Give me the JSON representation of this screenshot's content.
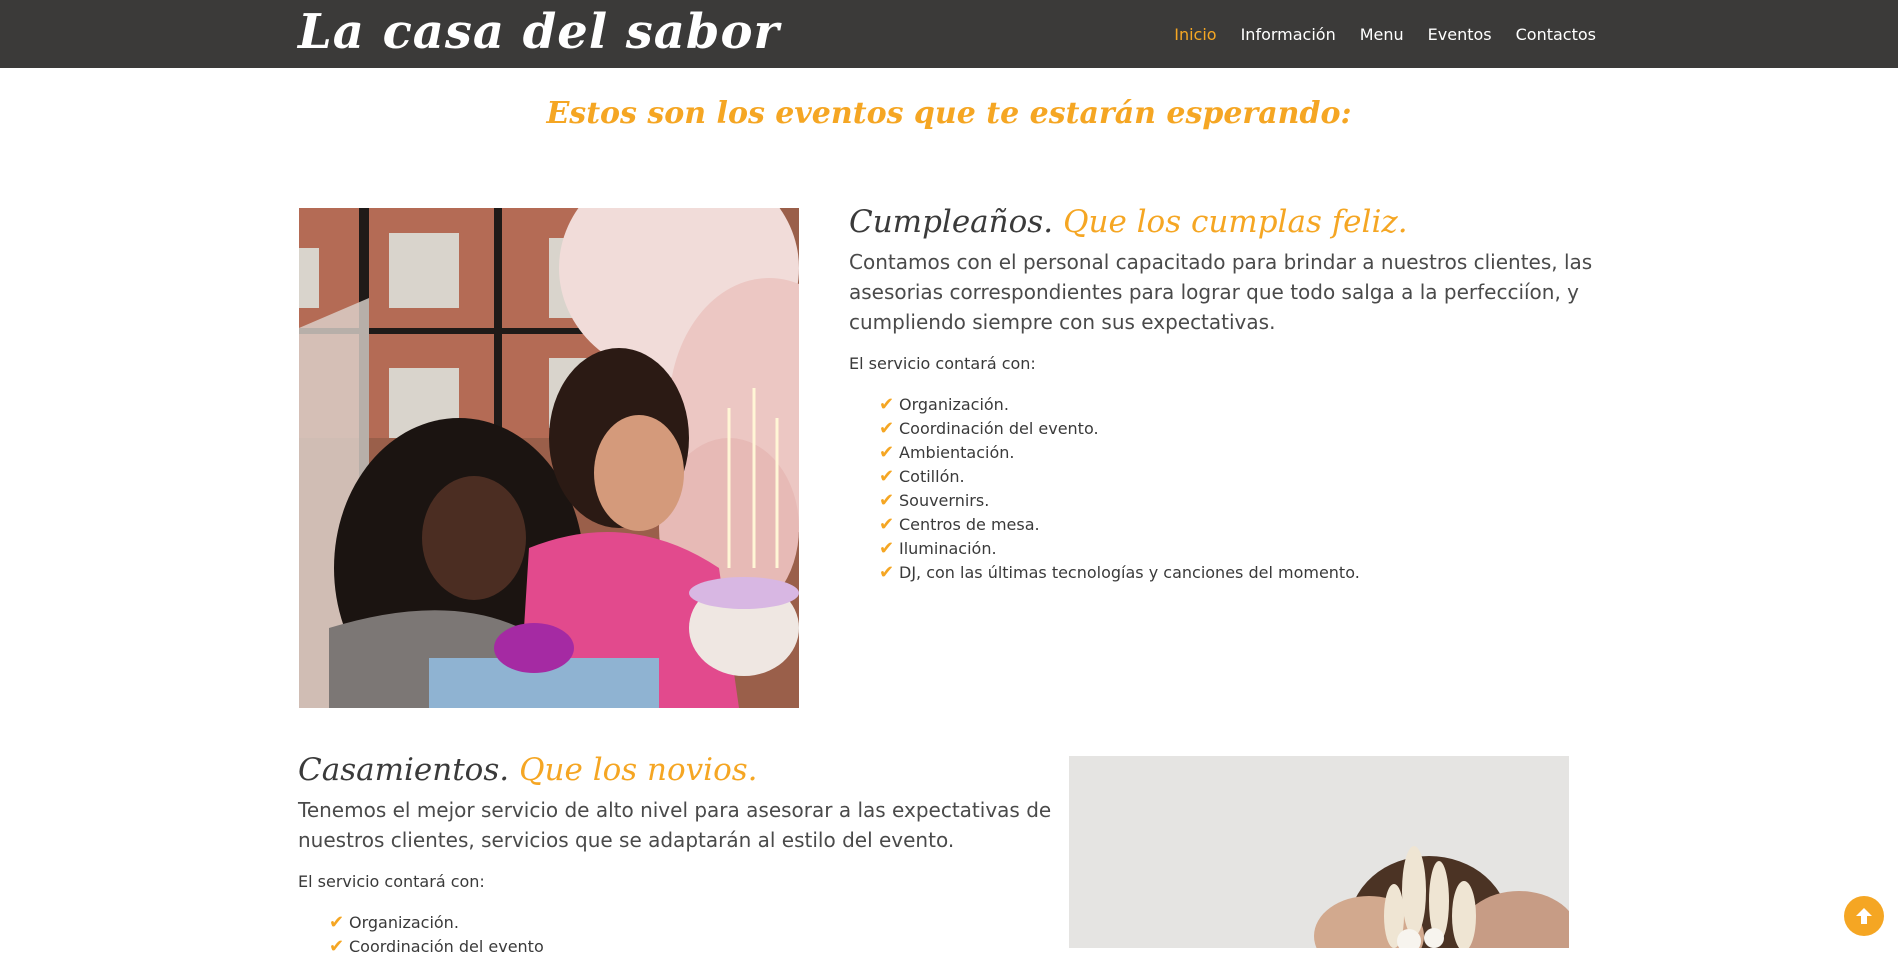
{
  "header": {
    "brand": "La casa del sabor",
    "nav": [
      {
        "label": "Inicio",
        "active": true
      },
      {
        "label": "Información",
        "active": false
      },
      {
        "label": "Menu",
        "active": false
      },
      {
        "label": "Eventos",
        "active": false
      },
      {
        "label": "Contactos",
        "active": false
      }
    ]
  },
  "events_section": {
    "title": "Estos son los eventos que te estarán esperando:"
  },
  "events": [
    {
      "heading_main": "Cumpleaños.",
      "heading_accent": "Que los cumplas feliz.",
      "description": "Contamos con el personal capacitado para brindar a nuestros clientes, las asesorias correspondientes para lograr que todo salga a la perfecciíon, y cumpliendo siempre con sus expectativas.",
      "intro": "El servicio contará con:",
      "features": [
        "Organización.",
        "Coordinación del evento.",
        "Ambientación.",
        "Cotillón.",
        "Souvernirs.",
        "Centros de mesa.",
        "Iluminación.",
        "DJ, con las últimas tecnologías y canciones del momento."
      ]
    },
    {
      "heading_main": "Casamientos.",
      "heading_accent": "Que los novios.",
      "description": "Tenemos el mejor servicio de alto nivel para asesorar a las expectativas de nuestros clientes, servicios que se adaptarán al estilo del evento.",
      "intro": "El servicio contará con:",
      "features": [
        "Organización.",
        "Coordinación del evento"
      ]
    }
  ],
  "icons": {
    "check": "checkmark-icon",
    "back_to_top": "arrow-up-icon"
  },
  "colors": {
    "accent": "#f5a623",
    "navbar": "#3b3a39",
    "text": "#3a3a3a"
  }
}
